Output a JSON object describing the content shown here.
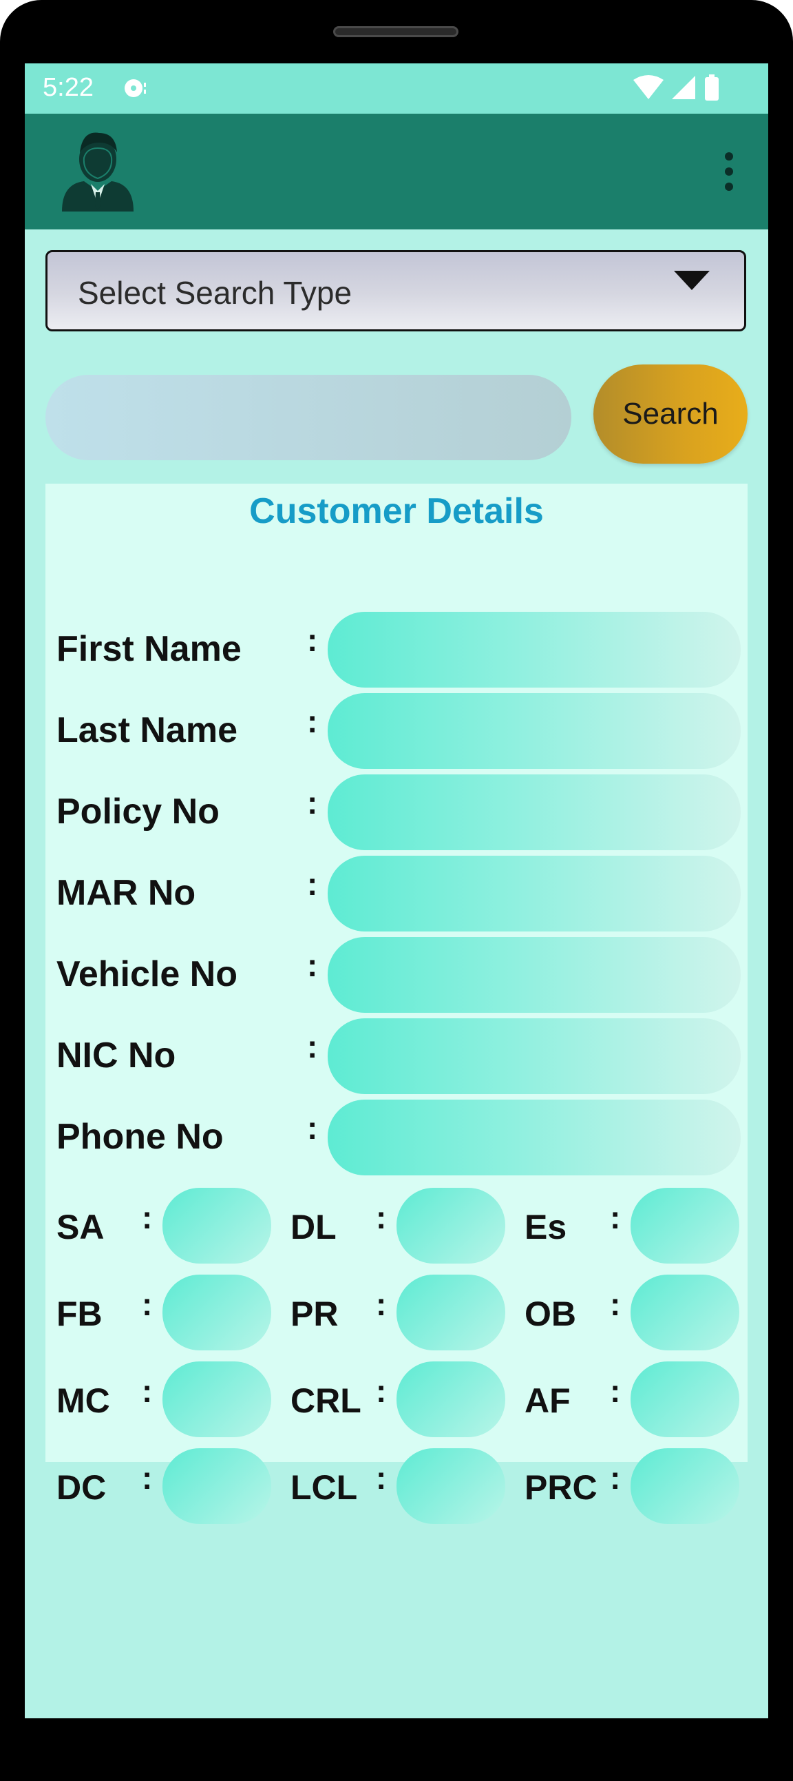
{
  "status_bar": {
    "time": "5:22",
    "notification_icon": "sync-disk-icon",
    "icons": [
      "wifi-icon",
      "signal-icon",
      "battery-icon"
    ]
  },
  "app_bar": {
    "avatar_icon": "user-avatar-icon",
    "menu_icon": "more-vert-icon"
  },
  "search": {
    "select_label": "Select Search Type",
    "input_placeholder": "",
    "input_value": "",
    "button_label": "Search"
  },
  "details": {
    "title": "Customer Details",
    "fields": [
      {
        "label": "First Name",
        "colon": ":",
        "value": ""
      },
      {
        "label": "Last Name",
        "colon": ":",
        "value": ""
      },
      {
        "label": "Policy No",
        "colon": ":",
        "value": ""
      },
      {
        "label": "MAR No",
        "colon": ":",
        "value": ""
      },
      {
        "label": "Vehicle No",
        "colon": ":",
        "value": ""
      },
      {
        "label": "NIC No",
        "colon": ":",
        "value": ""
      },
      {
        "label": "Phone No",
        "colon": ":",
        "value": ""
      }
    ],
    "grid": [
      [
        {
          "label": "SA",
          "colon": ":",
          "value": ""
        },
        {
          "label": "DL",
          "colon": ":",
          "value": ""
        },
        {
          "label": "Es",
          "colon": ":",
          "value": ""
        }
      ],
      [
        {
          "label": "FB",
          "colon": ":",
          "value": ""
        },
        {
          "label": "PR",
          "colon": ":",
          "value": ""
        },
        {
          "label": "OB",
          "colon": ":",
          "value": ""
        }
      ],
      [
        {
          "label": "MC",
          "colon": ":",
          "value": ""
        },
        {
          "label": "CRL",
          "colon": ":",
          "value": ""
        },
        {
          "label": "AF",
          "colon": ":",
          "value": ""
        }
      ],
      [
        {
          "label": "DC",
          "colon": ":",
          "value": ""
        },
        {
          "label": "LCL",
          "colon": ":",
          "value": ""
        },
        {
          "label": "PRC",
          "colon": ":",
          "value": ""
        }
      ]
    ]
  },
  "colors": {
    "status_bar": "#7de6d3",
    "app_bar": "#1b7f6b",
    "background": "#b3f2e6",
    "card": "#d8fdf4",
    "title": "#169cc7",
    "search_button": "#d9a21f",
    "input_fill": "#5eebd3"
  }
}
